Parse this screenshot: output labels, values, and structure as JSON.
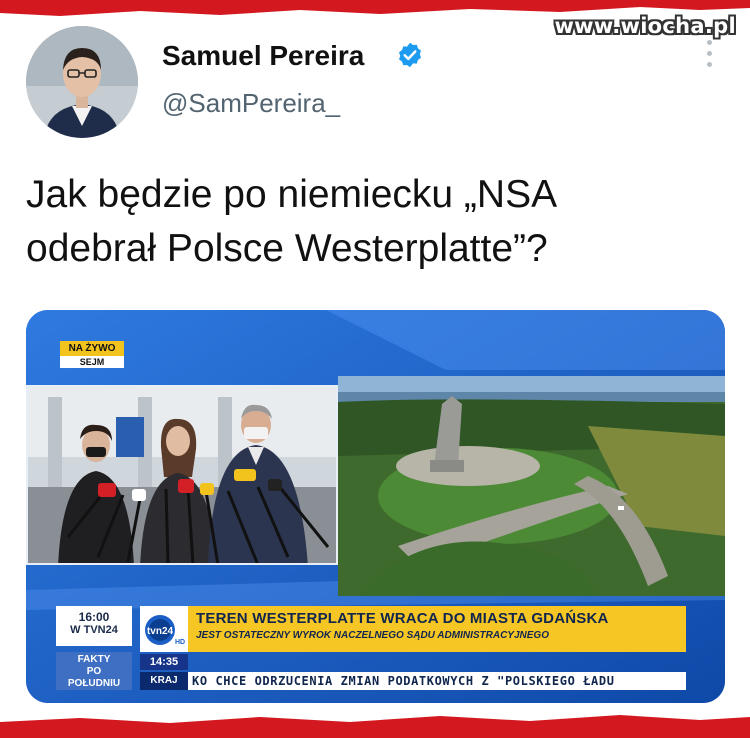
{
  "watermark": "www.wiocha.pl",
  "tweet": {
    "author_name": "Samuel Pereira",
    "handle": "@SamPereira_",
    "text_line1": "Jak będzie po niemiecku „NSA",
    "text_line2": "odebrał Polsce Westerplatte”?"
  },
  "icons": {
    "verified": "verified-badge-icon",
    "more": "more-options-icon"
  },
  "colors": {
    "verified_blue": "#1d9bf0",
    "torn_red": "#d41820",
    "tvn_yellow": "#f6c624",
    "tvn_blue": "#1b5fc6"
  },
  "broadcast": {
    "live_label": "NA ŻYWO",
    "live_location": "SEJM",
    "clock_time": "16:00",
    "clock_channel": "W TVN24",
    "program_line1": "FAKTY",
    "program_line2": "PO",
    "program_line3": "POŁUDNIU",
    "channel_logo": "tvn24 HD",
    "ticker_time": "14:35",
    "ticker_label": "KRAJ",
    "headline": "TEREN WESTERPLATTE WRACA DO MIASTA GDAŃSKA",
    "subheadline": "JEST OSTATECZNY WYROK NACZELNEGO SĄDU ADMINISTRACYJNEGO",
    "ticker_text": "KO CHCE ODRZUCENIA ZMIAN PODATKOWYCH Z \"POLSKIEGO ŁADU"
  }
}
